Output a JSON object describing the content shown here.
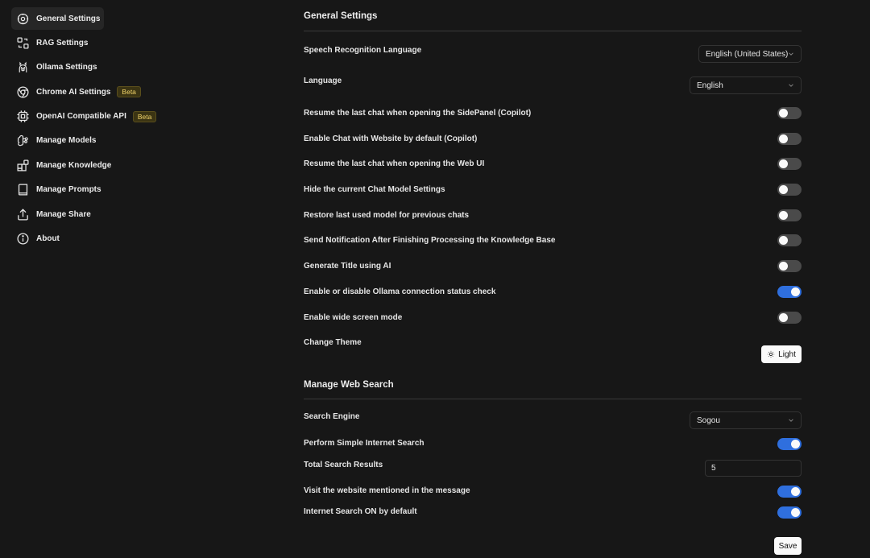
{
  "sidebar": {
    "items": [
      {
        "label": "General Settings",
        "icon": "settings-cog-icon"
      },
      {
        "label": "RAG Settings",
        "icon": "rag-icon"
      },
      {
        "label": "Ollama Settings",
        "icon": "ollama-llama-icon"
      },
      {
        "label": "Chrome AI Settings",
        "icon": "chrome-icon",
        "badge": "Beta"
      },
      {
        "label": "OpenAI Compatible API",
        "icon": "cpu-chip-icon",
        "badge": "Beta"
      },
      {
        "label": "Manage Models",
        "icon": "brain-icon"
      },
      {
        "label": "Manage Knowledge",
        "icon": "blocks-icon"
      },
      {
        "label": "Manage Prompts",
        "icon": "book-icon"
      },
      {
        "label": "Manage Share",
        "icon": "share-icon"
      },
      {
        "label": "About",
        "icon": "info-icon"
      }
    ]
  },
  "general": {
    "title": "General Settings",
    "speech_label": "Speech Recognition Language",
    "speech_value": "English (United States)",
    "language_label": "Language",
    "language_value": "English",
    "toggles": [
      {
        "label": "Resume the last chat when opening the SidePanel (Copilot)",
        "on": false
      },
      {
        "label": "Enable Chat with Website by default (Copilot)",
        "on": false
      },
      {
        "label": "Resume the last chat when opening the Web UI",
        "on": false
      },
      {
        "label": "Hide the current Chat Model Settings",
        "on": false
      },
      {
        "label": "Restore last used model for previous chats",
        "on": false
      },
      {
        "label": "Send Notification After Finishing Processing the Knowledge Base",
        "on": false
      },
      {
        "label": "Generate Title using AI",
        "on": false
      },
      {
        "label": "Enable or disable Ollama connection status check",
        "on": true
      },
      {
        "label": "Enable wide screen mode",
        "on": false
      }
    ],
    "theme_label": "Change Theme",
    "theme_button": "Light"
  },
  "web_search": {
    "title": "Manage Web Search",
    "engine_label": "Search Engine",
    "engine_value": "Sogou",
    "simple_search_label": "Perform Simple Internet Search",
    "simple_search_on": true,
    "total_results_label": "Total Search Results",
    "total_results_value": "5",
    "visit_website_label": "Visit the website mentioned in the message",
    "visit_website_on": true,
    "search_default_label": "Internet Search ON by default",
    "search_default_on": true,
    "save_label": "Save"
  },
  "colors": {
    "background": "#171717",
    "toggle_on": "#2f6fde",
    "toggle_off": "#4a4a4a",
    "badge_text": "#f2d46a"
  }
}
